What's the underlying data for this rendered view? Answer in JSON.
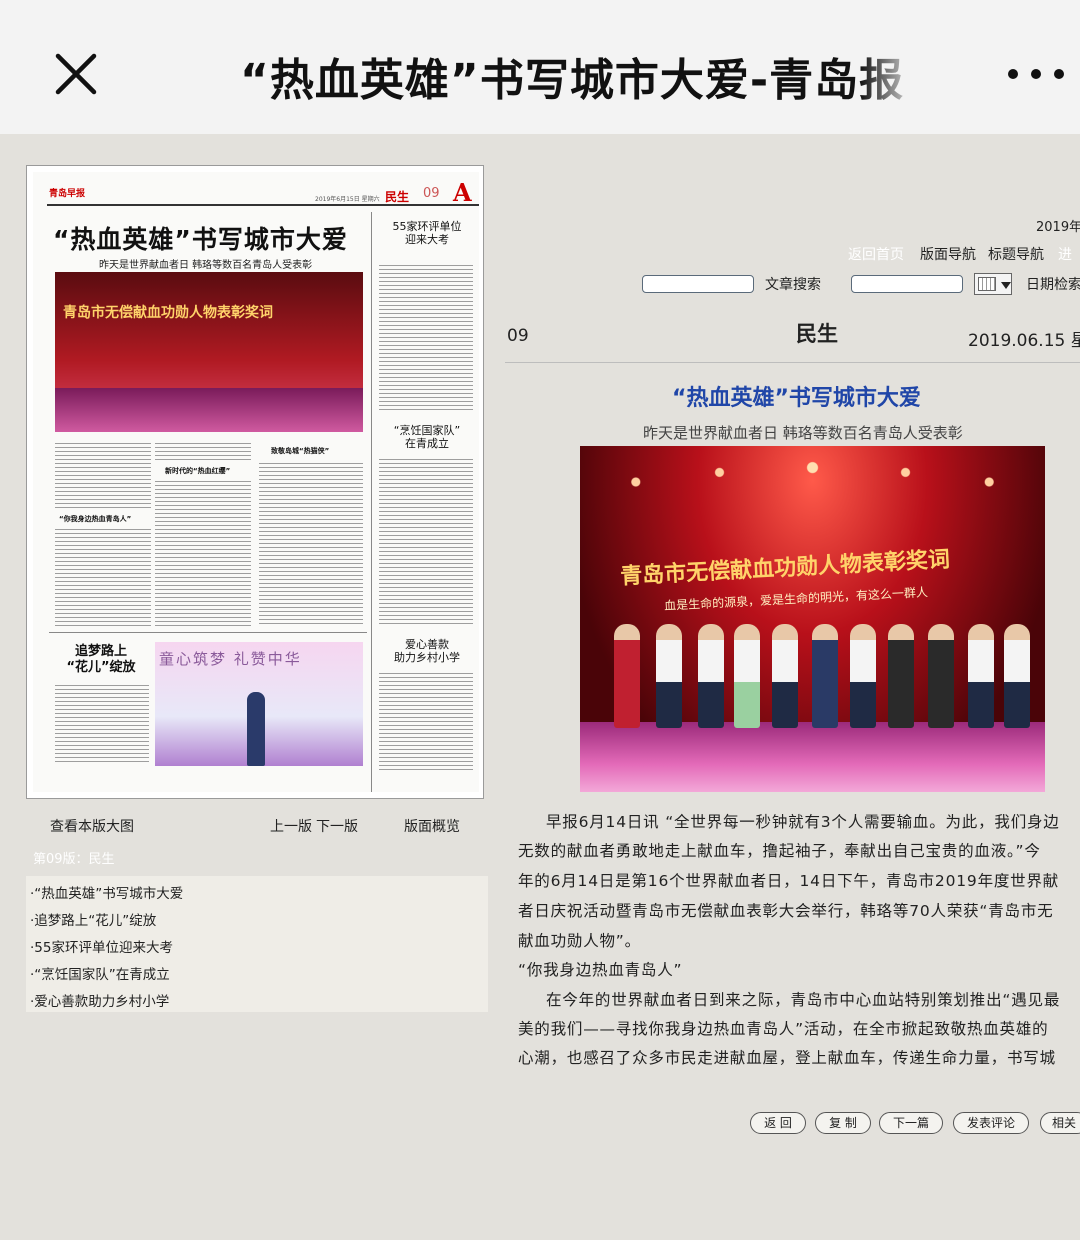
{
  "topbar": {
    "title": "“热血英雄”书写城市大爱-青岛报"
  },
  "newspaper": {
    "logo": "青岛早报",
    "date_line": "2019年6月15日 星期六",
    "section": "民生",
    "page_number": "09",
    "page_letter": "A",
    "headline": "“热血英雄”书写城市大爱",
    "subheadline": "昨天是世界献血者日  韩珞等数百名青岛人受表彰",
    "photo_banner": "青岛市无偿献血功勋人物表彰奖词",
    "side_story_1": [
      "55家环评单位",
      "迎来大考"
    ],
    "side_story_2": [
      "“烹饪国家队”",
      "在青成立"
    ],
    "side_story_3": [
      "爱心善款",
      "助力乡村小学"
    ],
    "bottom_story": [
      "追梦路上",
      "“花儿”绽放"
    ],
    "minihead_1": "“你我身边热血青岛人”",
    "minihead_2": "新时代的“热血红缨”",
    "minihead_3": "致敬岛城“热猫侠”",
    "photo2_banner": "童心筑梦 礼赞中华"
  },
  "left_controls": {
    "view_large": "查看本版大图",
    "prev_page": "上一版",
    "next_page": "下一版",
    "page_overview": "版面概览",
    "section_label": "第09版：民生",
    "articles": [
      "·“热血英雄”书写城市大爱",
      "·追梦路上“花儿”绽放",
      "·55家环评单位迎来大考",
      "·“烹饪国家队”在青成立",
      "·爱心善款助力乡村小学"
    ]
  },
  "right_nav": {
    "year_text": "2019年",
    "back_home": "返回首页",
    "layout_nav": "版面导航",
    "title_nav": "标题导航",
    "more_nav": "进",
    "article_search": "文章搜索",
    "date_search": "日期检索"
  },
  "article": {
    "page_number": "09",
    "section": "民生",
    "date": "2019.06.15 星",
    "headline": "“热血英雄”书写城市大爱",
    "subheadline": "昨天是世界献血者日 韩珞等数百名青岛人受表彰",
    "photo_banner": "青岛市无偿献血功勋人物表彰奖词",
    "photo_slogan": "血是生命的源泉，爱是生命的明光，有这么一群人",
    "lines": [
      "早报6月14日讯 “全世界每一秒钟就有3个人需要输血。为此，我们身边",
      "无数的献血者勇敢地走上献血车，撸起袖子，奉献出自己宝贵的血液。”今",
      "年的6月14日是第16个世界献血者日，14日下午，青岛市2019年度世界献",
      "者日庆祝活动暨青岛市无偿献血表彰大会举行，韩珞等70人荣获“青岛市无",
      "献血功勋人物”。",
      "“你我身边热血青岛人”",
      "在今年的世界献血者日到来之际，青岛市中心血站特别策划推出“遇见最",
      "美的我们——寻找你我身边热血青岛人”活动，在全市掀起致敬热血英雄的",
      "心潮，也感召了众多市民走进献血屋，登上献血车，传递生命力量，书写城"
    ]
  },
  "buttons": {
    "back": "返 回",
    "copy": "复 制",
    "next_article": "下一篇",
    "comment": "发表评论",
    "related": "相关"
  }
}
